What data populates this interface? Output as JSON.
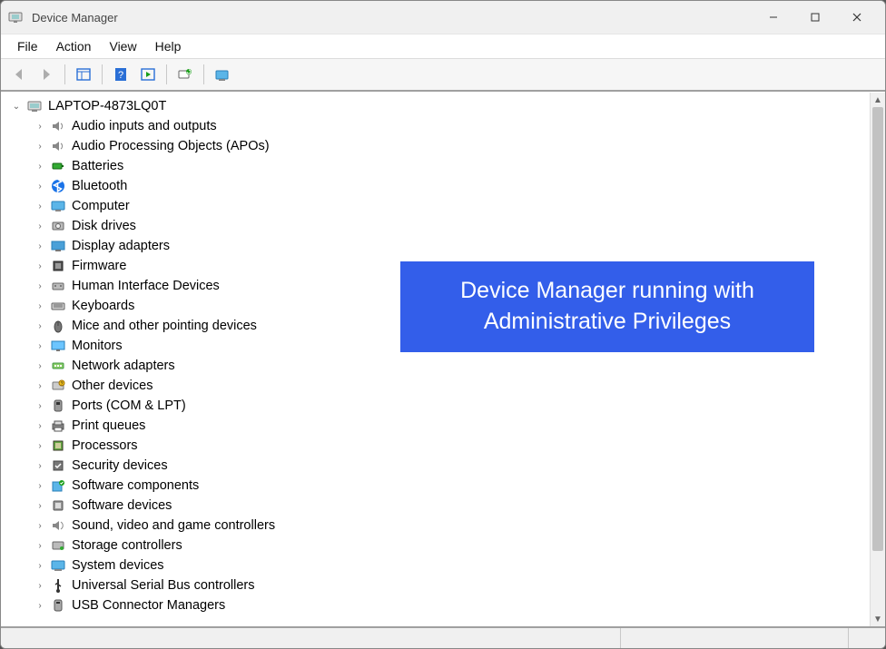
{
  "window": {
    "title": "Device Manager"
  },
  "menu": {
    "file": "File",
    "action": "Action",
    "view": "View",
    "help": "Help"
  },
  "tree": {
    "root": {
      "label": "LAPTOP-4873LQ0T",
      "expanded": true
    },
    "categories": [
      {
        "label": "Audio inputs and outputs",
        "icon": "speaker"
      },
      {
        "label": "Audio Processing Objects (APOs)",
        "icon": "speaker"
      },
      {
        "label": "Batteries",
        "icon": "battery"
      },
      {
        "label": "Bluetooth",
        "icon": "bluetooth"
      },
      {
        "label": "Computer",
        "icon": "computer"
      },
      {
        "label": "Disk drives",
        "icon": "disk"
      },
      {
        "label": "Display adapters",
        "icon": "display"
      },
      {
        "label": "Firmware",
        "icon": "chip"
      },
      {
        "label": "Human Interface Devices",
        "icon": "hid"
      },
      {
        "label": "Keyboards",
        "icon": "keyboard"
      },
      {
        "label": "Mice and other pointing devices",
        "icon": "mouse"
      },
      {
        "label": "Monitors",
        "icon": "monitor"
      },
      {
        "label": "Network adapters",
        "icon": "network"
      },
      {
        "label": "Other devices",
        "icon": "other"
      },
      {
        "label": "Ports (COM & LPT)",
        "icon": "port"
      },
      {
        "label": "Print queues",
        "icon": "printer"
      },
      {
        "label": "Processors",
        "icon": "cpu"
      },
      {
        "label": "Security devices",
        "icon": "security"
      },
      {
        "label": "Software components",
        "icon": "swcomp"
      },
      {
        "label": "Software devices",
        "icon": "swdev"
      },
      {
        "label": "Sound, video and game controllers",
        "icon": "sound"
      },
      {
        "label": "Storage controllers",
        "icon": "storage"
      },
      {
        "label": "System devices",
        "icon": "system"
      },
      {
        "label": "Universal Serial Bus controllers",
        "icon": "usb"
      },
      {
        "label": "USB Connector Managers",
        "icon": "usbconn"
      }
    ]
  },
  "callout": {
    "line1": "Device Manager running with",
    "line2": "Administrative Privileges"
  },
  "colors": {
    "callout_bg": "#335EEA",
    "callout_fg": "#FFFFFF"
  }
}
